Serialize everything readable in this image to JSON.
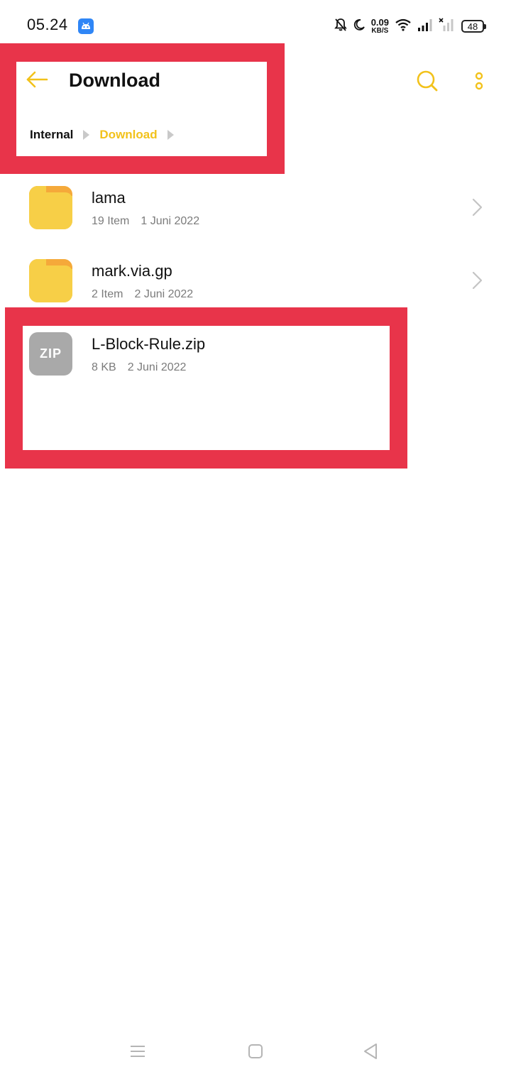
{
  "status_bar": {
    "time": "05.24",
    "speed_value": "0.09",
    "speed_unit": "KB/S",
    "battery": "48",
    "icons": [
      "android-app-icon",
      "bell-off-icon",
      "moon-icon",
      "wifi-icon",
      "signal-icon",
      "signal-no-service-icon",
      "battery-icon"
    ]
  },
  "header": {
    "title": "Download",
    "back_icon": "arrow-left-icon",
    "search_icon": "search-icon",
    "menu_icon": "more-vertical-icon",
    "accent_color": "#f2c21b"
  },
  "breadcrumb": {
    "items": [
      "Internal",
      "Download"
    ]
  },
  "files": [
    {
      "name": "lama",
      "type": "folder",
      "count": "19 Item",
      "date": "1 Juni 2022"
    },
    {
      "name": "mark.via.gp",
      "type": "folder",
      "count": "2 Item",
      "date": "2 Juni 2022"
    },
    {
      "name": "L-Block-Rule.zip",
      "type": "zip",
      "icon_label": "ZIP",
      "size": "8 KB",
      "date": "2 Juni 2022"
    }
  ],
  "highlight_color": "#e8344a",
  "nav_bar": {
    "icons": [
      "menu-lines-icon",
      "home-square-icon",
      "back-triangle-icon"
    ]
  }
}
